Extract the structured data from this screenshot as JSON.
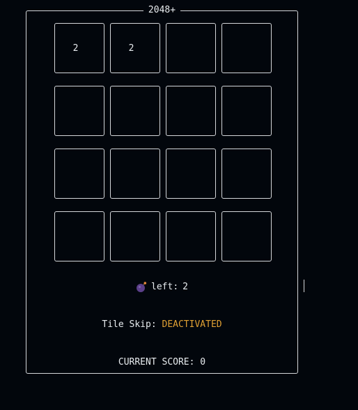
{
  "game": {
    "title": "2048+"
  },
  "board": {
    "rows": [
      [
        "2",
        "2",
        "",
        ""
      ],
      [
        "",
        "",
        "",
        ""
      ],
      [
        "",
        "",
        "",
        ""
      ],
      [
        "",
        "",
        "",
        ""
      ]
    ]
  },
  "bombs": {
    "icon": "bomb-icon",
    "label": "left:",
    "count": "2"
  },
  "tile_skip": {
    "label": "Tile Skip:",
    "status": "DEACTIVATED",
    "status_color": "#e0a033"
  },
  "score": {
    "label": "CURRENT SCORE:",
    "value": "0"
  }
}
